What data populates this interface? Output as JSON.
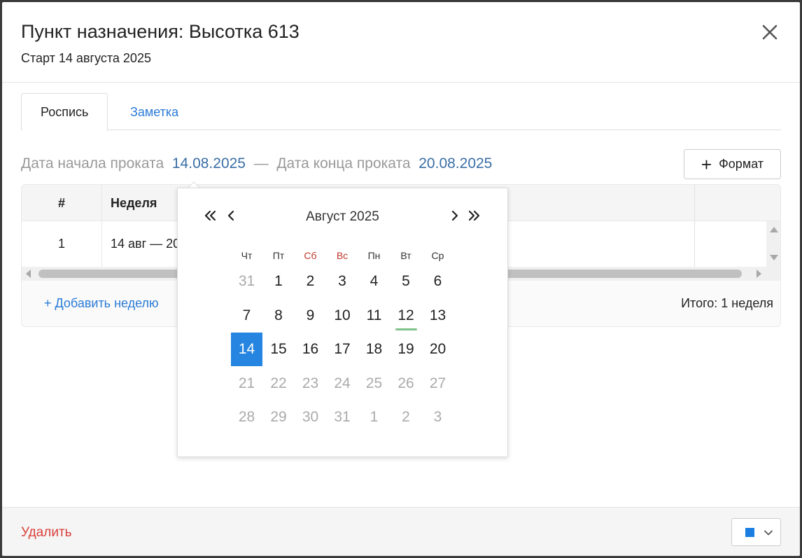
{
  "header": {
    "title": "Пункт назначения: Высотка 613",
    "subtitle": "Старт 14 августа 2025"
  },
  "tabs": [
    {
      "label": "Роспись",
      "active": true
    },
    {
      "label": "Заметка",
      "active": false
    }
  ],
  "range": {
    "start_label": "Дата начала проката",
    "start_value": "14.08.2025",
    "separator": "—",
    "end_label": "Дата конца проката",
    "end_value": "20.08.2025"
  },
  "toolbar": {
    "format_label": "Формат"
  },
  "table": {
    "columns": [
      "#",
      "Неделя"
    ],
    "rows": [
      {
        "num": "1",
        "week": "14 авг — 20"
      }
    ],
    "add_label": "+ Добавить неделю",
    "total": "Итого: 1 неделя"
  },
  "footer": {
    "delete_label": "Удалить",
    "color": "#1a7ee3"
  },
  "datepicker": {
    "month_label": "Август 2025",
    "weekdays": [
      "Чт",
      "Пт",
      "Сб",
      "Вс",
      "Пн",
      "Вт",
      "Ср"
    ],
    "weekend_color": "#c0392b",
    "weeks": [
      [
        "31",
        "1",
        "2",
        "3",
        "4",
        "5",
        "6"
      ],
      [
        "7",
        "8",
        "9",
        "10",
        "11",
        "12",
        "13"
      ],
      [
        "14",
        "15",
        "16",
        "17",
        "18",
        "19",
        "20"
      ],
      [
        "21",
        "22",
        "23",
        "24",
        "25",
        "26",
        "27"
      ],
      [
        "28",
        "29",
        "30",
        "31",
        "1",
        "2",
        "3"
      ]
    ],
    "selected_day": "14",
    "today_day": "12",
    "selected_color": "#2585e0",
    "today_marker_color": "#7fc18a"
  }
}
